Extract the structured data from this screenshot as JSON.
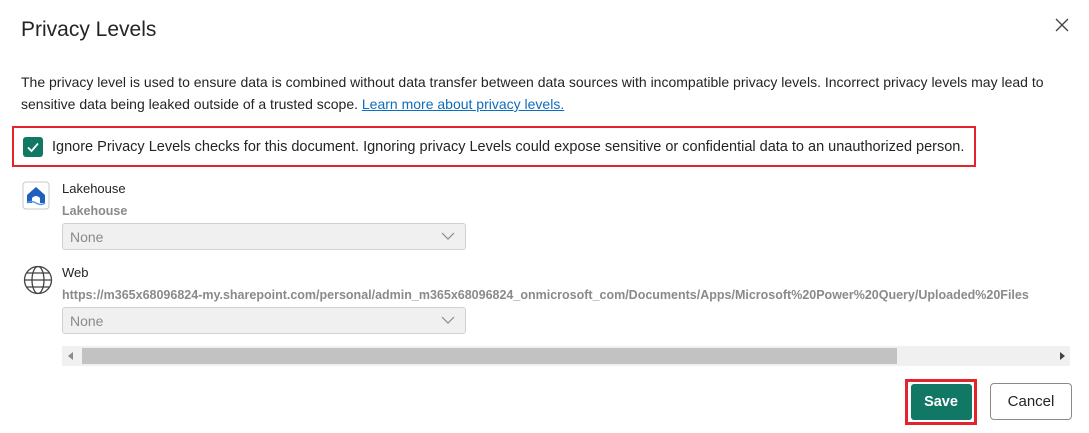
{
  "dialog": {
    "title": "Privacy Levels",
    "description": "The privacy level is used to ensure data is combined without data transfer between data sources with incompatible privacy levels. Incorrect privacy levels may lead to sensitive data being leaked outside of a trusted scope. ",
    "learn_more_link": "Learn more about privacy levels."
  },
  "ignore_checks": {
    "checked": true,
    "label": "Ignore Privacy Levels checks for this document. Ignoring privacy Levels could expose sensitive or confidential data to an unauthorized person."
  },
  "sources": [
    {
      "name": "Lakehouse",
      "path": "Lakehouse",
      "icon": "lakehouse-icon",
      "privacy_level": "None"
    },
    {
      "name": "Web",
      "path": "https://m365x68096824-my.sharepoint.com/personal/admin_m365x68096824_onmicrosoft_com/Documents/Apps/Microsoft%20Power%20Query/Uploaded%20Files",
      "icon": "globe-icon",
      "privacy_level": "None"
    }
  ],
  "buttons": {
    "save": "Save",
    "cancel": "Cancel"
  },
  "colors": {
    "accent": "#117865",
    "highlight": "#e3242b",
    "link": "#0f6cbd"
  }
}
